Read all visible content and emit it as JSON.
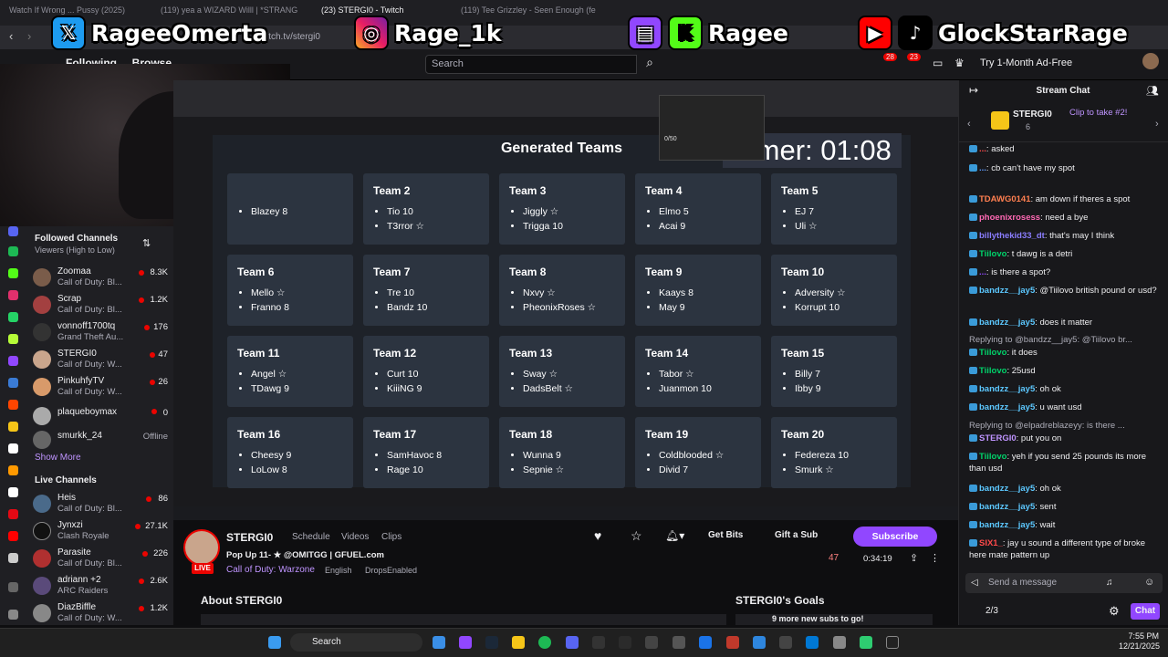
{
  "browser": {
    "tabs": [
      "Watch If Wrong ... Pussy (2025)",
      "(119) yea a WIZARD Willl | *STRANG",
      "(23) STERGI0 - Twitch",
      "(119) Tee Grizzley - Seen Enough (fe"
    ],
    "url": "twitch.tv/stergi0"
  },
  "nav": {
    "following": "Following",
    "browse": "Browse",
    "search_placeholder": "Search",
    "notif1": "28",
    "notif2": "23",
    "ad_free": "Try 1-Month Ad-Free"
  },
  "social": {
    "twitter": "RageeOmerta",
    "instagram": "Rage_1k",
    "twitch_kick": "Ragee",
    "youtube_tiktok": "GlockStarRage"
  },
  "sidebar": {
    "followed_header": "Followed Channels",
    "followed_sub": "Viewers (High to Low)",
    "followed": [
      {
        "name": "Zoomaa",
        "game": "Call of Duty: Bl...",
        "viewers": "8.3K"
      },
      {
        "name": "Scrap",
        "game": "Call of Duty: Bl...",
        "viewers": "1.2K"
      },
      {
        "name": "vonnoff1700tq",
        "game": "Grand Theft Au...",
        "viewers": "176"
      },
      {
        "name": "STERGI0",
        "game": "Call of Duty: W...",
        "viewers": "47"
      },
      {
        "name": "PinkuhfyTV",
        "game": "Call of Duty: W...",
        "viewers": "26"
      },
      {
        "name": "plaqueboymax",
        "game": "",
        "viewers": "0"
      },
      {
        "name": "smurkk_24",
        "game": "",
        "viewers": "Offline"
      }
    ],
    "show_more": "Show More",
    "live_header": "Live Channels",
    "live": [
      {
        "name": "Heis",
        "game": "Call of Duty: Bl...",
        "viewers": "86"
      },
      {
        "name": "Jynxzi",
        "game": "Clash Royale",
        "viewers": "27.1K"
      },
      {
        "name": "Parasite",
        "game": "Call of Duty: Bl...",
        "viewers": "226"
      },
      {
        "name": "adriann +2",
        "game": "ARC Raiders",
        "viewers": "2.6K"
      },
      {
        "name": "DiazBiffle",
        "game": "Call of Duty: W...",
        "viewers": "1.2K"
      }
    ]
  },
  "stream": {
    "panel_title": "Generated Teams",
    "timer": "Timer: 01:08",
    "mini_counter": "0/50",
    "teams": [
      {
        "name": "",
        "players": [
          "",
          "Blazey 8"
        ]
      },
      {
        "name": "Team 2",
        "players": [
          "Tio 10",
          "T3rror ☆"
        ]
      },
      {
        "name": "Team 3",
        "players": [
          "Jiggly ☆",
          "Trigga 10"
        ]
      },
      {
        "name": "Team 4",
        "players": [
          "Elmo 5",
          "Acai 9"
        ]
      },
      {
        "name": "Team 5",
        "players": [
          "EJ 7",
          "Uli ☆"
        ]
      },
      {
        "name": "Team 6",
        "players": [
          "Mello ☆",
          "Franno 8"
        ]
      },
      {
        "name": "Team 7",
        "players": [
          "Tre 10",
          "Bandz 10"
        ]
      },
      {
        "name": "Team 8",
        "players": [
          "Nxvy ☆",
          "PheonixRoses ☆"
        ]
      },
      {
        "name": "Team 9",
        "players": [
          "Kaays 8",
          "May 9"
        ]
      },
      {
        "name": "Team 10",
        "players": [
          "Adversity ☆",
          "Korrupt 10"
        ]
      },
      {
        "name": "Team 11",
        "players": [
          "Angel ☆",
          "TDawg 9"
        ]
      },
      {
        "name": "Team 12",
        "players": [
          "Curt 10",
          "KiiiNG 9"
        ]
      },
      {
        "name": "Team 13",
        "players": [
          "Sway ☆",
          "DadsBelt ☆"
        ]
      },
      {
        "name": "Team 14",
        "players": [
          "Tabor ☆",
          "Juanmon 10"
        ]
      },
      {
        "name": "Team 15",
        "players": [
          "Billy 7",
          "Ibby 9"
        ]
      },
      {
        "name": "Team 16",
        "players": [
          "Cheesy 9",
          "LoLow 8"
        ]
      },
      {
        "name": "Team 17",
        "players": [
          "SamHavoc 8",
          "Rage 10"
        ]
      },
      {
        "name": "Team 18",
        "players": [
          "Wunna 9",
          "Sepnie ☆"
        ]
      },
      {
        "name": "Team 19",
        "players": [
          "Coldblooded ☆",
          "Divid 7"
        ]
      },
      {
        "name": "Team 20",
        "players": [
          "Federeza 10",
          "Smurk ☆"
        ]
      }
    ]
  },
  "channel": {
    "name": "STERGI0",
    "links": [
      "Schedule",
      "Videos",
      "Clips"
    ],
    "title": "Pop Up 11- ★ @OMITGG | GFUEL.com",
    "game": "Call of Duty: Warzone",
    "tags": [
      "English",
      "DropsEnabled"
    ],
    "live": "LIVE",
    "get_bits": "Get Bits",
    "gift_sub": "Gift a Sub",
    "subscribe": "Subscribe",
    "viewers": "47",
    "uptime": "0:34:19",
    "about": "About STERGI0",
    "goals": "STERGI0's Goals",
    "goal_text": "9 more new subs to go!"
  },
  "chat": {
    "title": "Stream Chat",
    "pinned_user": "STERGI0",
    "pinned_count": "6",
    "pinned_clip": "Clip to take #2!",
    "messages": [
      {
        "user": "...",
        "color": "#ff4a4a",
        "text": ": asked"
      },
      {
        "user": "...",
        "color": "#5b99ff",
        "text": ": cb can't have my spot"
      },
      {
        "user": "TDAWG0141",
        "color": "#ff7f50",
        "text": ": am down if theres a spot"
      },
      {
        "user": "phoenixrosess",
        "color": "#ff69b4",
        "text": ": need a bye"
      },
      {
        "user": "billythekid33_dt",
        "color": "#8a7dff",
        "text": ": that's may I think"
      },
      {
        "user": "Tiilovo",
        "color": "#00d26a",
        "text": ": t dawg is a detri"
      },
      {
        "user": "...",
        "color": "#9147ff",
        "text": ": is there a spot?"
      },
      {
        "user": "bandzz__jay5",
        "color": "#5cc8ff",
        "text": ": @Tiilovo british pound or usd?"
      },
      {
        "user": "bandzz__jay5",
        "color": "#5cc8ff",
        "text": ": does it matter"
      },
      {
        "user": "Tiilovo",
        "color": "#00d26a",
        "text": ": it does"
      },
      {
        "user": "Tiilovo",
        "color": "#00d26a",
        "text": ": 25usd"
      },
      {
        "user": "bandzz__jay5",
        "color": "#5cc8ff",
        "text": ": oh ok"
      },
      {
        "user": "bandzz__jay5",
        "color": "#5cc8ff",
        "text": ": u want usd"
      },
      {
        "user": "STERGI0",
        "color": "#bf94ff",
        "text": ": put you on"
      },
      {
        "user": "Tiilovo",
        "color": "#00d26a",
        "text": ": yeh if you send 25 pounds its more than usd"
      },
      {
        "user": "bandzz__jay5",
        "color": "#5cc8ff",
        "text": ": oh ok"
      },
      {
        "user": "bandzz__jay5",
        "color": "#5cc8ff",
        "text": ": sent"
      },
      {
        "user": "bandzz__jay5",
        "color": "#5cc8ff",
        "text": ": wait"
      },
      {
        "user": "SIX1_",
        "color": "#ff4a4a",
        "text": ": jay u sound a different type of broke here mate pattern up"
      }
    ],
    "reply1": "Replying to @bandzz__jay5: @Tiilovo br...",
    "reply2": "Replying to @elpadreblazeyy: is there ...",
    "input_placeholder": "Send a message",
    "points": "2/3",
    "chat_button": "Chat"
  },
  "taskbar": {
    "search": "Search",
    "time": "7:55 PM",
    "date": "12/21/2025"
  }
}
